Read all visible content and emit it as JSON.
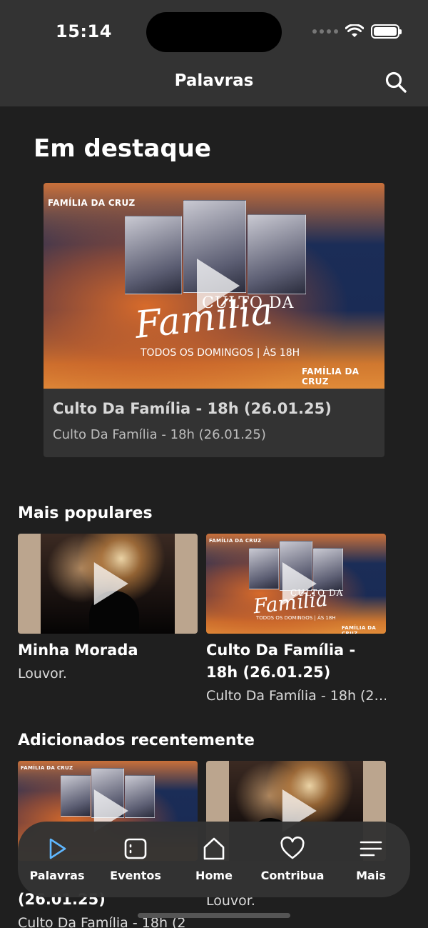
{
  "status": {
    "time": "15:14"
  },
  "header": {
    "title": "Palavras"
  },
  "colors": {
    "accent": "#5fb7ff",
    "background": "#1f1f1f",
    "surface": "#333333"
  },
  "featured": {
    "heading": "Em destaque",
    "title": "Culto Da Família - 18h (26.01.25)",
    "subtitle": "Culto Da Família - 18h (26.01.25)",
    "art": {
      "brand": "FAMÍLIA DA CRUZ",
      "culto": "CULTO  DA",
      "familia": "Família",
      "schedule": "TODOS OS DOMINGOS |  ÀS 18H"
    }
  },
  "popular": {
    "heading": "Mais populares",
    "items": [
      {
        "title": "Minha Morada",
        "subtitle": "Louvor."
      },
      {
        "title": "Culto Da Família - 18h (26.01.25)",
        "subtitle": "Culto Da Família - 18h (2…"
      }
    ]
  },
  "recent": {
    "heading": "Adicionados recentemente",
    "items": [
      {
        "title": "(26.01.25)",
        "subtitle": "Culto Da Família - 18h (2"
      },
      {
        "title": "",
        "subtitle": "Louvor."
      }
    ]
  },
  "tabbar": {
    "items": [
      {
        "label": "Palavras",
        "icon": "play-icon",
        "active": true
      },
      {
        "label": "Eventos",
        "icon": "calendar-icon"
      },
      {
        "label": "Home",
        "icon": "home-icon"
      },
      {
        "label": "Contribua",
        "icon": "heart-icon"
      },
      {
        "label": "Mais",
        "icon": "menu-icon"
      }
    ]
  }
}
